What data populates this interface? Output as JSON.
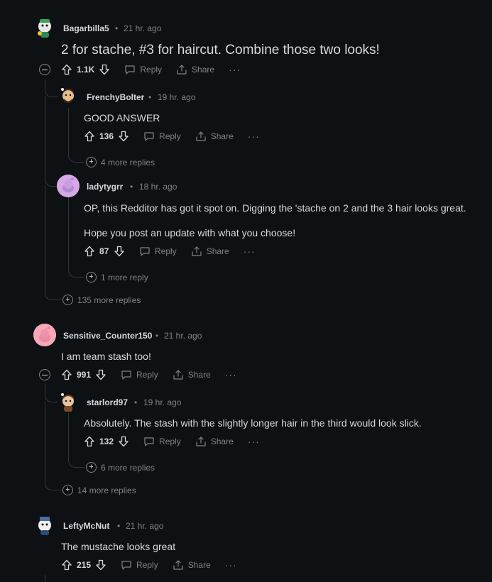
{
  "comments": [
    {
      "author": "Bagarbilla5",
      "age": "21 hr. ago",
      "text": "2 for stache, #3 for haircut. Combine those two looks!",
      "votes": "1.1K",
      "replies_more": "135 more replies",
      "replies": [
        {
          "author": "FrenchyBolter",
          "age": "19 hr. ago",
          "text": [
            "GOOD ANSWER"
          ],
          "votes": "136",
          "more": "4 more replies"
        },
        {
          "author": "ladytygrr",
          "age": "18 hr. ago",
          "text": [
            "OP, this Redditor has got it spot on. Digging the 'stache on 2 and the 3 hair looks great.",
            "Hope you post an update with what you choose!"
          ],
          "votes": "87",
          "more": "1 more reply"
        }
      ]
    },
    {
      "author": "Sensitive_Counter150",
      "age": "21 hr. ago",
      "text": "I am team stash too!",
      "votes": "991",
      "replies_more": "14 more replies",
      "replies": [
        {
          "author": "starlord97",
          "age": "19 hr. ago",
          "text": [
            "Absolutely. The stash with the slightly longer hair in the third would look slick."
          ],
          "votes": "132",
          "more": "6 more replies"
        }
      ]
    },
    {
      "author": "LeftyMcNut",
      "age": "21 hr. ago",
      "text": "The mustache looks great",
      "votes": "215"
    }
  ],
  "labels": {
    "reply": "Reply",
    "share": "Share",
    "separator": "•",
    "overflow": "···"
  },
  "icons": {
    "upvote": "upvote-icon",
    "downvote": "downvote-icon",
    "reply": "reply-icon",
    "share": "share-icon",
    "expand": "plus-circle-icon",
    "collapse": "minus-circle-icon"
  },
  "colors": {
    "background": "#0e1113",
    "text": "#d7dadc",
    "muted": "#818384",
    "thread_line": "#343536"
  }
}
